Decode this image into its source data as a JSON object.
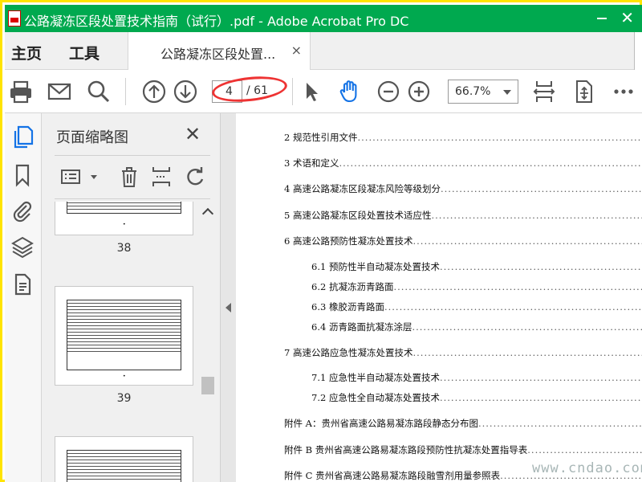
{
  "window": {
    "title": "公路凝冻区段处置技术指南（试行）.pdf - Adobe Acrobat Pro DC"
  },
  "nav": {
    "home_label": "主页",
    "tools_label": "工具",
    "doc_tab_label": "公路凝冻区段处置...",
    "close_glyph": "×"
  },
  "toolbar": {
    "current_page": "4",
    "page_total": "/ 61",
    "zoom": "66.7%",
    "icons": [
      "print-icon",
      "email-icon",
      "search-icon",
      "page-up-icon",
      "page-down-icon",
      "select-arrow-icon",
      "hand-icon",
      "zoom-out-icon",
      "zoom-in-icon",
      "fit-page-icon",
      "page-resize-icon",
      "more-icon"
    ]
  },
  "left_rail": {
    "icons": [
      "page-thumbnails-icon",
      "bookmark-icon",
      "attachment-icon",
      "layers-icon",
      "document-icon"
    ]
  },
  "panel": {
    "title": "页面缩略图",
    "close_glyph": "✕",
    "thumb_labels": [
      "38",
      "39"
    ],
    "thumb_label_dot": "•"
  },
  "toc": [
    {
      "text": "2 规范性引用文件",
      "level": 1
    },
    {
      "text": "3 术语和定义",
      "level": 1
    },
    {
      "text": "4 高速公路凝冻区段凝冻风险等级划分",
      "level": 1
    },
    {
      "text": "5 高速公路凝冻区段处置技术适应性",
      "level": 1
    },
    {
      "text": "6 高速公路预防性凝冻处置技术",
      "level": 1
    },
    {
      "text": "6.1 预防性半自动凝冻处置技术",
      "level": 2
    },
    {
      "text": "6.2 抗凝冻沥青路面",
      "level": 2
    },
    {
      "text": "6.3 橡胶沥青路面",
      "level": 2
    },
    {
      "text": "6.4 沥青路面抗凝冻涂层",
      "level": 2
    },
    {
      "text": "7 高速公路应急性凝冻处置技术",
      "level": 1
    },
    {
      "text": "7.1 应急性半自动凝冻处置技术",
      "level": 2
    },
    {
      "text": "7.2 应急性全自动凝冻处置技术",
      "level": 2
    },
    {
      "text": "附件 A：贵州省高速公路易凝冻路段静态分布图",
      "level": 1
    },
    {
      "text": "附件 B 贵州省高速公路易凝冻路段预防性抗凝冻处置指导表",
      "level": 1
    },
    {
      "text": "附件 C 贵州省高速公路易凝冻路段融雪剂用量参照表",
      "level": 1
    }
  ],
  "watermark": "www.cndao.com",
  "colors": {
    "title_bar": "#00a94f",
    "frame": "#ffe400",
    "hand_tool": "#1473e6",
    "annotation_ring": "#e33333"
  }
}
